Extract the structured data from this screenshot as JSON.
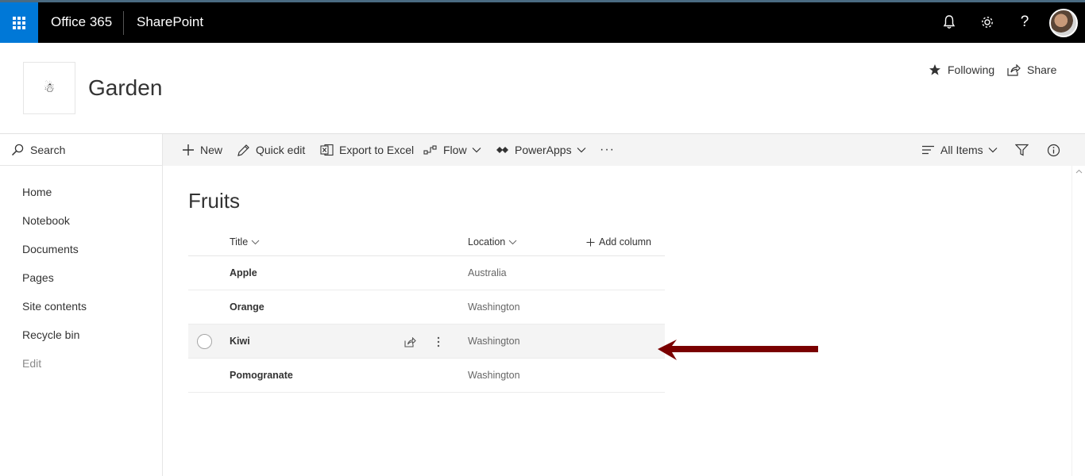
{
  "suite": {
    "title": "Office 365",
    "app": "SharePoint"
  },
  "site": {
    "logo_glyph": "☃",
    "title": "Garden",
    "following_label": "Following",
    "share_label": "Share"
  },
  "leftnav": {
    "search_label": "Search",
    "items": [
      {
        "label": "Home"
      },
      {
        "label": "Notebook"
      },
      {
        "label": "Documents"
      },
      {
        "label": "Pages"
      },
      {
        "label": "Site contents"
      },
      {
        "label": "Recycle bin"
      },
      {
        "label": "Edit"
      }
    ]
  },
  "commandbar": {
    "new_label": "New",
    "quick_edit_label": "Quick edit",
    "export_label": "Export to Excel",
    "flow_label": "Flow",
    "powerapps_label": "PowerApps",
    "more_label": "···",
    "view_label": "All Items"
  },
  "list": {
    "title": "Fruits",
    "columns": {
      "title": "Title",
      "location": "Location",
      "add_column": "Add column"
    },
    "rows": [
      {
        "title": "Apple",
        "location": "Australia"
      },
      {
        "title": "Orange",
        "location": "Washington"
      },
      {
        "title": "Kiwi",
        "location": "Washington"
      },
      {
        "title": "Pomogranate",
        "location": "Washington"
      }
    ]
  },
  "colors": {
    "suitebar": "#000000",
    "waffle": "#0078d7",
    "annotation_arrow": "#7a0000"
  },
  "icons": [
    "waffle-icon",
    "bell-icon",
    "gear-icon",
    "help-icon",
    "star-icon",
    "share-icon",
    "search-icon",
    "plus-icon",
    "pencil-icon",
    "excel-icon",
    "flow-icon",
    "powerapps-icon",
    "chevron-down-icon",
    "view-icon",
    "filter-icon",
    "info-icon",
    "more-vertical-icon"
  ]
}
